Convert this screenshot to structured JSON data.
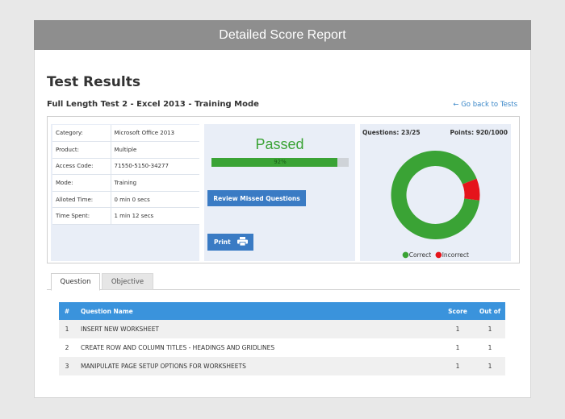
{
  "banner": {
    "title": "Detailed Score Report"
  },
  "page": {
    "title": "Test Results",
    "subtitle": "Full Length Test 2 - Excel 2013 - Training Mode",
    "back_link": "← Go back to Tests"
  },
  "info": [
    {
      "key": "Category:",
      "value": "Microsoft Office 2013"
    },
    {
      "key": "Product:",
      "value": "Multiple"
    },
    {
      "key": "Access Code:",
      "value": "71550-5150-34277"
    },
    {
      "key": "Mode:",
      "value": "Training"
    },
    {
      "key": "Alloted Time:",
      "value": "0 min 0 secs"
    },
    {
      "key": "Time Spent:",
      "value": "1 min 12 secs"
    }
  ],
  "result": {
    "status": "Passed",
    "percent": 92,
    "percent_label": "92%",
    "review_button": "Review Missed Questions",
    "print_button": "Print",
    "print_icon": "printer-icon"
  },
  "stats": {
    "questions": "Questions: 23/25",
    "points": "Points: 920/1000"
  },
  "chart_data": {
    "type": "pie",
    "categories": [
      "Correct",
      "Incorrect"
    ],
    "values": [
      23,
      2
    ],
    "colors": [
      "#3aa335",
      "#e5141b"
    ],
    "legend_position": "bottom"
  },
  "tabs": [
    {
      "label": "Question",
      "active": true
    },
    {
      "label": "Objective",
      "active": false
    }
  ],
  "table": {
    "headers": [
      "#",
      "Question Name",
      "Score",
      "Out of"
    ],
    "rows": [
      {
        "num": "1",
        "name": "INSERT NEW WORKSHEET",
        "score": "1",
        "out": "1"
      },
      {
        "num": "2",
        "name": "CREATE ROW AND COLUMN TITLES - HEADINGS AND GRIDLINES",
        "score": "1",
        "out": "1"
      },
      {
        "num": "3",
        "name": "MANIPULATE PAGE SETUP OPTIONS FOR WORKSHEETS",
        "score": "1",
        "out": "1"
      }
    ]
  },
  "colors": {
    "accent_blue": "#3a93dc",
    "button_blue": "#3a7bc4",
    "pass_green": "#3aa335",
    "incorrect_red": "#e5141b"
  }
}
